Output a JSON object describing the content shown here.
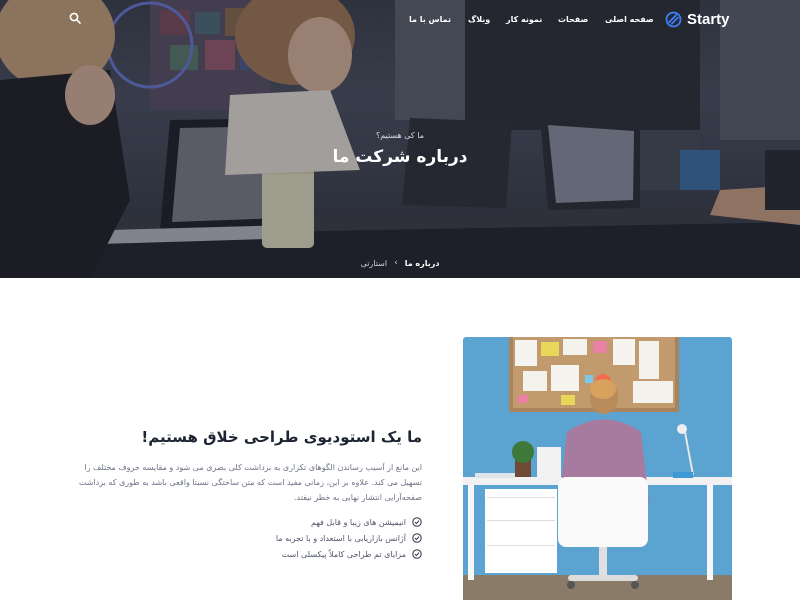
{
  "brand": {
    "name": "Starty",
    "accent": "#3c7cf0"
  },
  "nav": {
    "items": [
      "صفحه اصلی",
      "صفحات",
      "نمونه کار",
      "وبلاگ",
      "تماس با ما"
    ]
  },
  "icons": {
    "search": "search-icon",
    "check": "check-circle-icon",
    "breadcrumb_separator": "chevron-icon"
  },
  "hero": {
    "eyebrow": "ما کی هستیم؟",
    "title": "درباره شرکت ما",
    "breadcrumb": {
      "home": "استارتی",
      "current": "درباره ما"
    }
  },
  "about": {
    "title": "ما یک استودیوی طراحی خلاق هستیم!",
    "text": "این مانع از آسیب رساندن الگوهای تکراری به برداشت کلی بصری می شود و مقایسه حروف مختلف را تسهیل می کند. علاوه بر این، زمانی مفید است که متن ساختگی نسبتا واقعی باشد به طوری که برداشت صفحه‌آرایی انتشار نهایی به خطر نیفتد.",
    "features": [
      "انیمیشن های زیبا و قابل فهم",
      "آژانس بازاریابی با استعداد و با تجربه ما",
      "مزایای تم طراحی کاملاً پیکسلی است"
    ]
  }
}
